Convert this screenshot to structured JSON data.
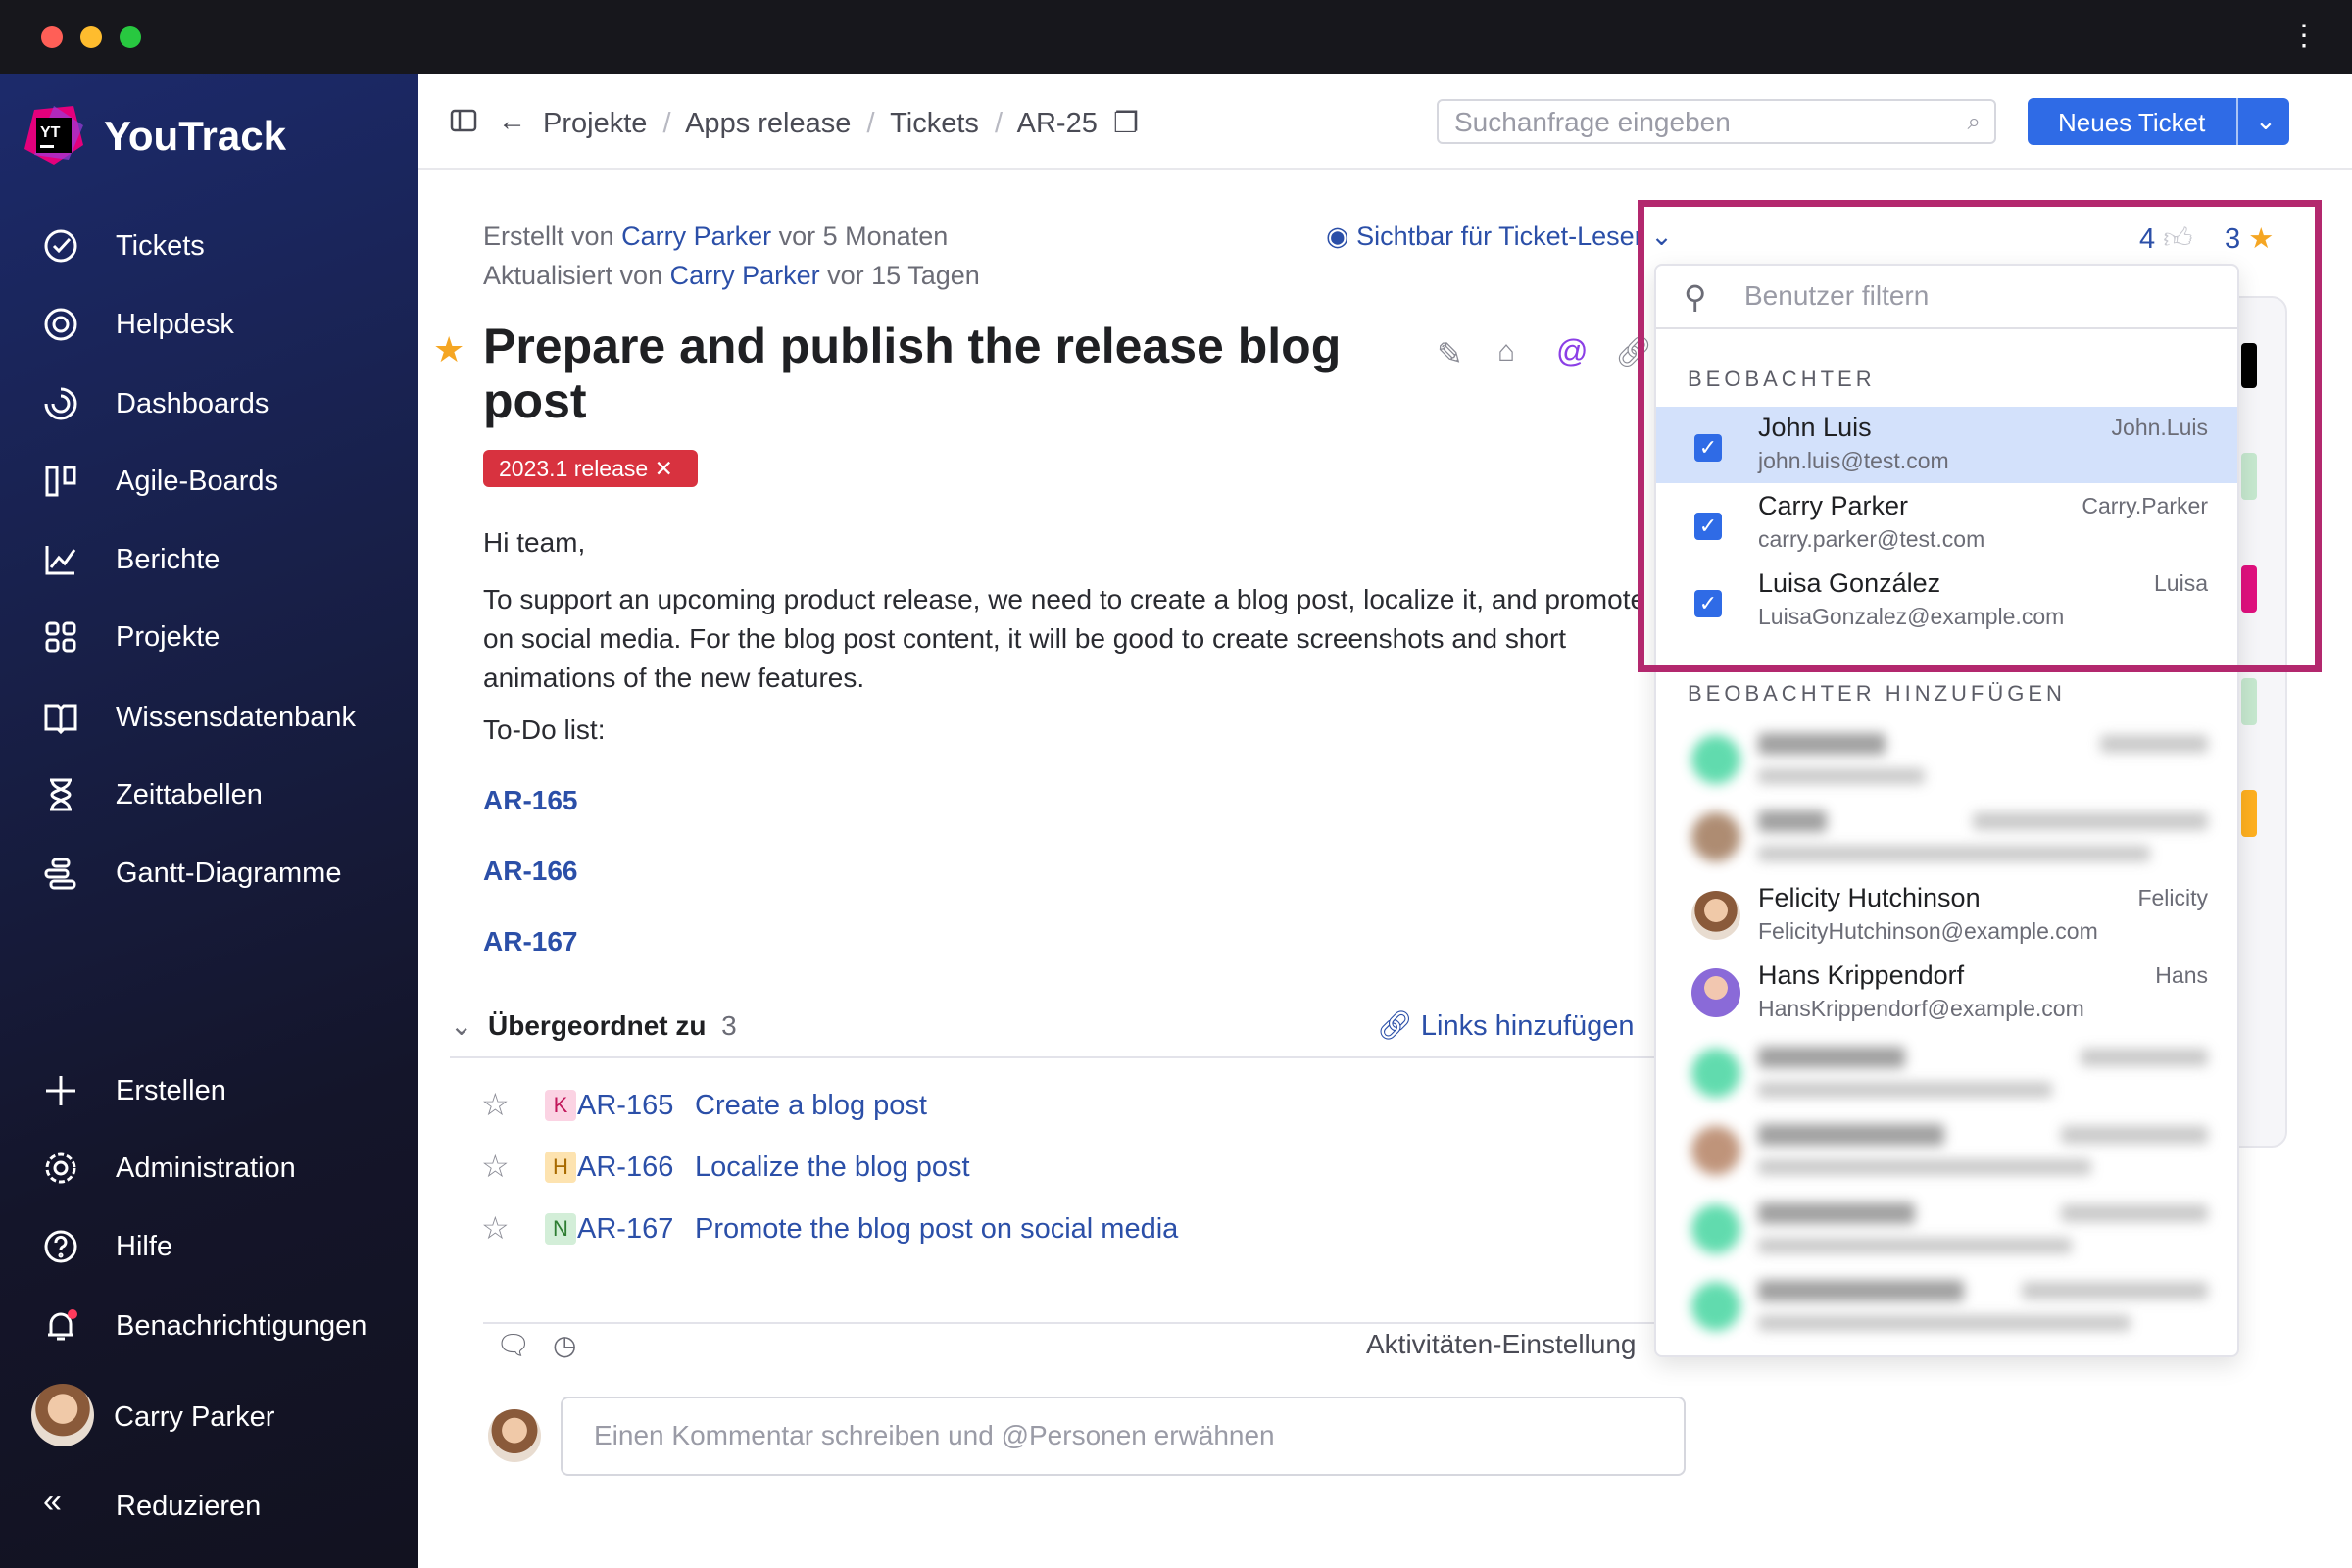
{
  "app": {
    "name": "YouTrack",
    "logo_text": "YT"
  },
  "colors": {
    "accent": "#2f6be6",
    "highlight": "#b3286e",
    "tag": "#d8323f",
    "star": "#f5a623"
  },
  "sidebar": {
    "items": [
      {
        "label": "Tickets",
        "icon": "check-circle-icon"
      },
      {
        "label": "Helpdesk",
        "icon": "lifebuoy-icon"
      },
      {
        "label": "Dashboards",
        "icon": "gauge-icon"
      },
      {
        "label": "Agile-Boards",
        "icon": "board-icon"
      },
      {
        "label": "Berichte",
        "icon": "chart-icon"
      },
      {
        "label": "Projekte",
        "icon": "grid-icon"
      },
      {
        "label": "Wissensdatenbank",
        "icon": "book-icon"
      },
      {
        "label": "Zeittabellen",
        "icon": "hourglass-icon"
      },
      {
        "label": "Gantt-Diagramme",
        "icon": "gantt-icon"
      }
    ],
    "bottom": [
      {
        "label": "Erstellen",
        "icon": "plus-icon"
      },
      {
        "label": "Administration",
        "icon": "gear-icon"
      },
      {
        "label": "Hilfe",
        "icon": "help-icon"
      },
      {
        "label": "Benachrichtigungen",
        "icon": "bell-icon"
      }
    ],
    "user": "Carry Parker",
    "collapse": "Reduzieren"
  },
  "breadcrumb": [
    "Projekte",
    "Apps release",
    "Tickets",
    "AR-25"
  ],
  "search": {
    "placeholder": "Suchanfrage eingeben"
  },
  "new_ticket": "Neues Ticket",
  "issue": {
    "created_prefix": "Erstellt von",
    "created_by": "Carry Parker",
    "created_when": "vor 5 Monaten",
    "updated_prefix": "Aktualisiert von",
    "updated_by": "Carry Parker",
    "updated_when": "vor 15 Tagen",
    "visibility": "Sichtbar für Ticket-Leser",
    "votes": "4",
    "stars": "3",
    "title": "Prepare and publish the release blog post",
    "tag": "2023.1 release",
    "greeting": "Hi team,",
    "paragraph": "To support an upcoming product release, we need to create a blog post, localize it, and promote it on social media. For the blog post content, it will be good to create screenshots and short animations of the new features.",
    "todo": "To-Do list:",
    "todo_links": [
      "AR-165",
      "AR-166",
      "AR-167"
    ],
    "links_section": {
      "label": "Übergeordnet zu",
      "count": "3",
      "add": "Links hinzufügen"
    },
    "subtasks": [
      {
        "priority": "K",
        "id": "AR-165",
        "title": "Create a blog post",
        "bg": "#fbd3e3",
        "fg": "#c2185b"
      },
      {
        "priority": "H",
        "id": "AR-166",
        "title": "Localize the blog post",
        "bg": "#fde3b0",
        "fg": "#a86a00"
      },
      {
        "priority": "N",
        "id": "AR-167",
        "title": "Promote the blog post on social media",
        "bg": "#d3eed8",
        "fg": "#2e7d32"
      }
    ],
    "activity_settings": "Aktivitäten-Einstellung",
    "comment_placeholder": "Einen Kommentar schreiben und @Personen erwähnen"
  },
  "watchers_popup": {
    "filter_placeholder": "Benutzer filtern",
    "watchers_header": "BEOBACHTER",
    "watchers": [
      {
        "name": "John Luis",
        "login": "John.Luis",
        "email": "john.luis@test.com",
        "checked": true,
        "selected": true
      },
      {
        "name": "Carry Parker",
        "login": "Carry.Parker",
        "email": "carry.parker@test.com",
        "checked": true
      },
      {
        "name": "Luisa González",
        "login": "Luisa",
        "email": "LuisaGonzalez@example.com",
        "checked": true
      }
    ],
    "add_header": "BEOBACHTER HINZUFÜGEN",
    "candidates": [
      {
        "name": "Felicity Hutchinson",
        "login": "Felicity",
        "email": "FelicityHutchinson@example.com"
      },
      {
        "name": "Hans Krippendorf",
        "login": "Hans",
        "email": "HansKrippendorf@example.com"
      }
    ]
  }
}
